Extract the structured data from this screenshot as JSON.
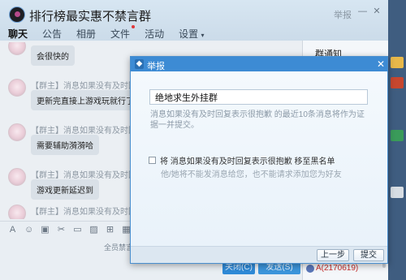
{
  "window": {
    "title": "排行榜最实惠不禁言群",
    "report_link": "举报",
    "tabs": [
      {
        "label": "聊天"
      },
      {
        "label": "公告"
      },
      {
        "label": "相册"
      },
      {
        "label": "文件"
      },
      {
        "label": "活动"
      },
      {
        "label": "设置"
      }
    ]
  },
  "messages": [
    {
      "meta": "",
      "text": "会很快的"
    },
    {
      "meta": "【群主】消息如果没有及时回复表示很抱歉",
      "text": "更新完直接上游戏玩就行了。冷糖无"
    },
    {
      "meta": "【群主】消息如果没有及时回复表示很抱歉",
      "text": "需要辅助漪漪哈"
    },
    {
      "meta": "【群主】消息如果没有及时回复表示很抱歉",
      "text": "游戏更新延迟到"
    },
    {
      "meta": "【群主】消息如果没有及时回复表示很抱歉",
      "text": ""
    }
  ],
  "input": {
    "note": "全员禁言",
    "close_label": "关闭(C)",
    "send_label": "发送(S)"
  },
  "right_panel": {
    "notice_title": "群通知",
    "member_name": "A(2170619)"
  },
  "dialog": {
    "title": "举报",
    "reason_value": "绝地求生外挂群",
    "hint": "消息如果没有及时回复表示很抱歉 的最近10条消息将作为证据一并提交。",
    "block_label": "将 消息如果没有及时回复表示很抱歉 移至黑名单",
    "block_desc": "他/她将不能发消息给您，也不能请求添加您为好友",
    "block_checked": false,
    "prev_label": "上一步",
    "submit_label": "提交"
  },
  "colors": {
    "accent": "#3d8bd4",
    "header_bg": "#d7e6f2",
    "member_name": "#c8302e"
  }
}
